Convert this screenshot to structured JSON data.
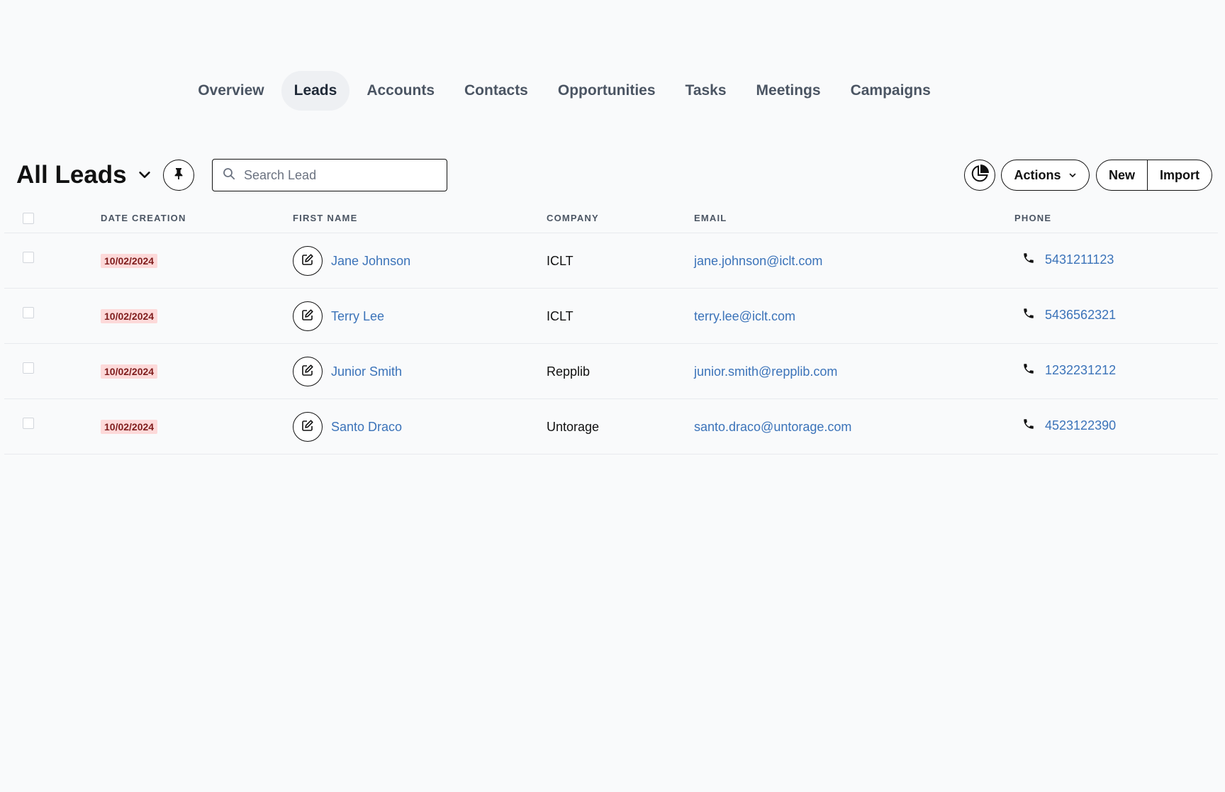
{
  "nav": {
    "tabs": [
      {
        "label": "Overview",
        "active": false
      },
      {
        "label": "Leads",
        "active": true
      },
      {
        "label": "Accounts",
        "active": false
      },
      {
        "label": "Contacts",
        "active": false
      },
      {
        "label": "Opportunities",
        "active": false
      },
      {
        "label": "Tasks",
        "active": false
      },
      {
        "label": "Meetings",
        "active": false
      },
      {
        "label": "Campaigns",
        "active": false
      }
    ]
  },
  "toolbar": {
    "title": "All Leads",
    "search_placeholder": "Search Lead",
    "search_value": "",
    "actions_label": "Actions",
    "new_label": "New",
    "import_label": "Import",
    "icons": {
      "title_dropdown": "chevron-down-icon",
      "pin": "pin-icon",
      "search": "search-icon",
      "chart": "pie-chart-icon",
      "actions_dropdown": "chevron-down-icon"
    }
  },
  "table": {
    "columns": [
      "DATE CREATION",
      "FIRST NAME",
      "COMPANY",
      "EMAIL",
      "PHONE"
    ],
    "rows": [
      {
        "date": "10/02/2024",
        "name": "Jane Johnson",
        "company": "ICLT",
        "email": "jane.johnson@iclt.com",
        "phone": "5431211123"
      },
      {
        "date": "10/02/2024",
        "name": "Terry Lee",
        "company": "ICLT",
        "email": "terry.lee@iclt.com",
        "phone": "5436562321"
      },
      {
        "date": "10/02/2024",
        "name": "Junior Smith",
        "company": "Repplib",
        "email": "junior.smith@repplib.com",
        "phone": "1232231212"
      },
      {
        "date": "10/02/2024",
        "name": "Santo Draco",
        "company": "Untorage",
        "email": "santo.draco@untorage.com",
        "phone": "4523122390"
      }
    ]
  },
  "colors": {
    "background": "#f9fafb",
    "link": "#3b73b9",
    "date_badge_bg": "#fdd9d9",
    "date_badge_text": "#7f1d1d",
    "active_tab_bg": "#eef0f3"
  }
}
